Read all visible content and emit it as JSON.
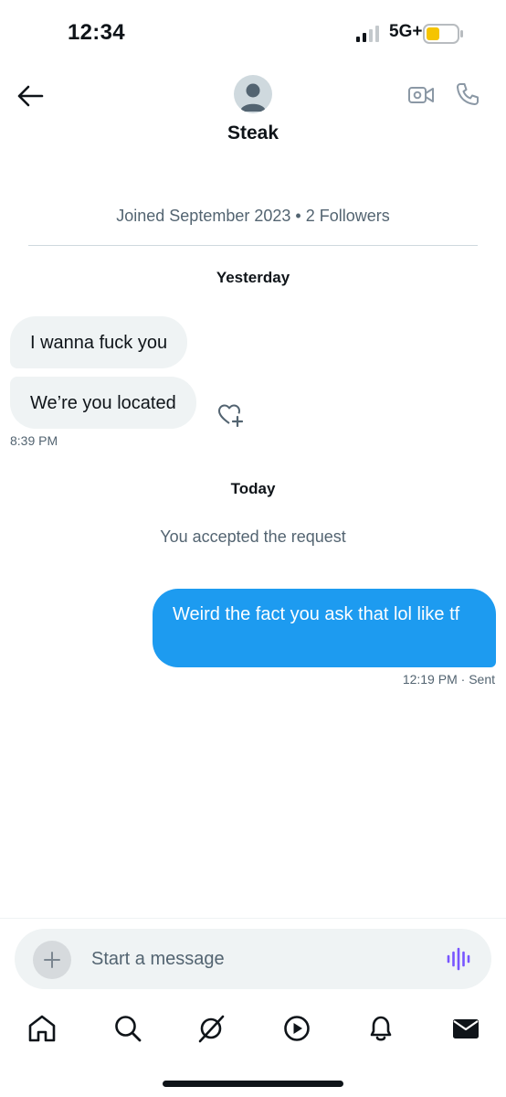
{
  "status_bar": {
    "time": "12:34",
    "network": "5G+",
    "battery_color": "#f5c400"
  },
  "header": {
    "contact_name": "Steak",
    "icons": {
      "back": "arrow-left-icon",
      "video": "video-camera-icon",
      "call": "phone-icon"
    }
  },
  "profile_meta": "Joined September 2023 • 2 Followers",
  "conversation": {
    "yesterday_label": "Yesterday",
    "incoming": [
      {
        "text": "I wanna fuck you"
      },
      {
        "text": "We’re you located"
      }
    ],
    "incoming_time": "8:39 PM",
    "today_label": "Today",
    "system_message": "You accepted the request",
    "outgoing": {
      "text": "Weird the fact you ask that lol like tf",
      "time": "12:19 PM",
      "status": "· Sent"
    }
  },
  "composer": {
    "placeholder": "Start a message",
    "accent": "#7856ff"
  },
  "bottom_nav": [
    "home-icon",
    "search-icon",
    "grok-icon",
    "video-play-icon",
    "notifications-icon",
    "messages-icon"
  ],
  "colors": {
    "brand_blue": "#1d9bf0",
    "bubble_gray": "#eff3f4",
    "text_secondary": "#536471"
  }
}
